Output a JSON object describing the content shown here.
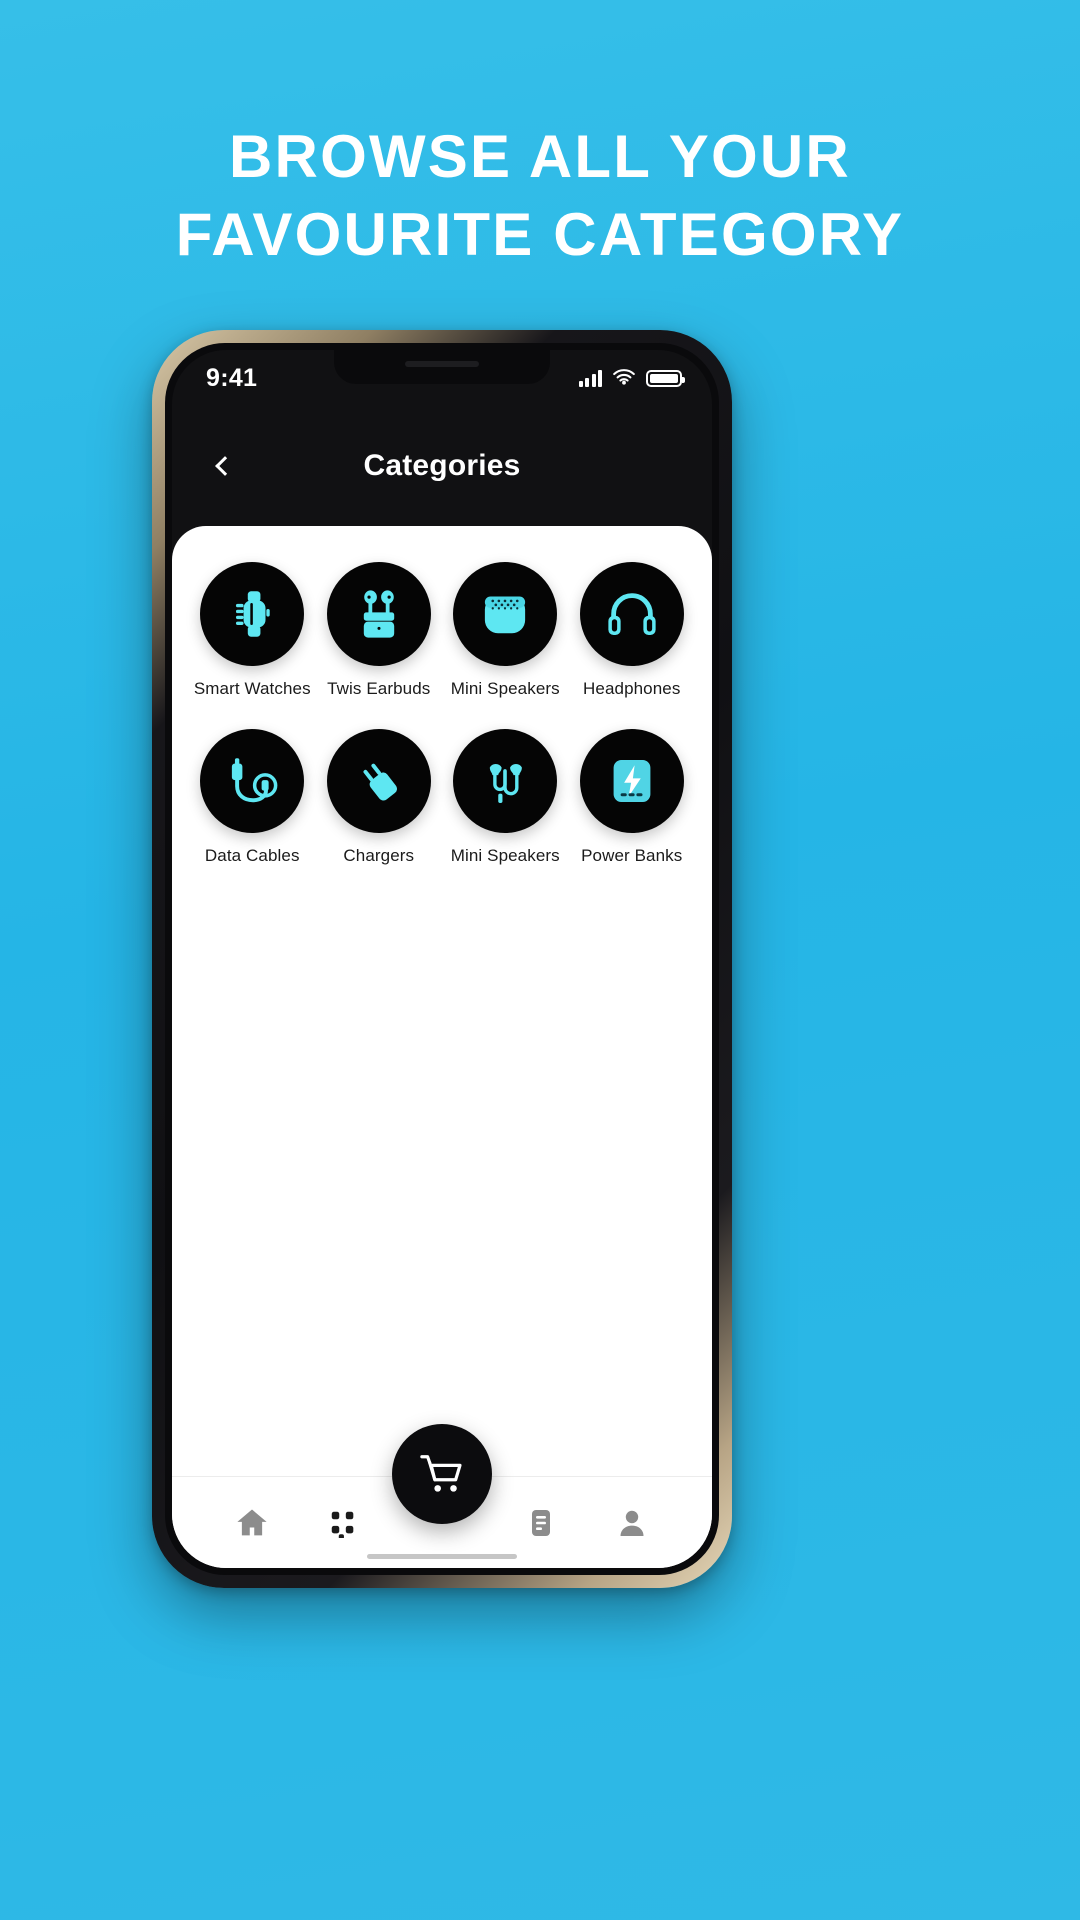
{
  "banner": {
    "background_color": "#2cb8e8",
    "headline_lines": [
      "Browse All Your",
      "Favourite Category"
    ],
    "headline_color": "#ffffff"
  },
  "phone": {
    "status_bar": {
      "time": "9:41",
      "signal_icon": "cellular-signal-icon",
      "wifi_icon": "wifi-icon",
      "battery_icon": "battery-full-icon"
    },
    "header": {
      "back_icon": "chevron-left-icon",
      "title": "Categories"
    },
    "accent_color": "#5ee7f2",
    "tile_color": "#050505",
    "sheet_color": "#ffffff",
    "categories": [
      {
        "label": "Smart Watches",
        "icon": "smart-watch-icon"
      },
      {
        "label": "Twis Earbuds",
        "icon": "earbuds-case-icon"
      },
      {
        "label": "Mini Speakers",
        "icon": "mini-speaker-icon"
      },
      {
        "label": "Headphones",
        "icon": "headphones-icon"
      },
      {
        "label": "Data Cables",
        "icon": "data-cable-icon"
      },
      {
        "label": "Chargers",
        "icon": "charger-plug-icon"
      },
      {
        "label": "Mini Speakers",
        "icon": "wired-earphones-icon"
      },
      {
        "label": "Power Banks",
        "icon": "power-bank-icon"
      }
    ],
    "bottom_nav": {
      "items": [
        {
          "icon": "home-icon",
          "active": true
        },
        {
          "icon": "grid-apps-icon",
          "active": false
        },
        {
          "icon": "list-document-icon",
          "active": false
        },
        {
          "icon": "person-account-icon",
          "active": false
        }
      ],
      "fab_icon": "shopping-cart-icon"
    }
  }
}
